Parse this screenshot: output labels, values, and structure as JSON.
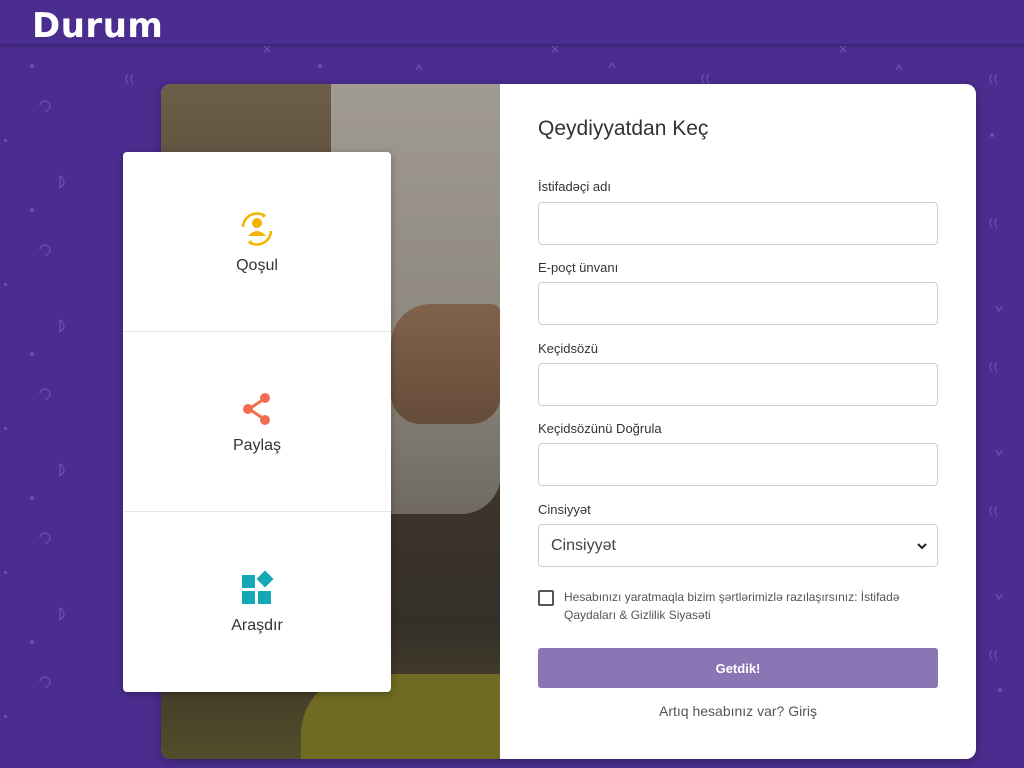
{
  "app": {
    "logo": "Durum"
  },
  "colors": {
    "brand_purple": "#4b2d8f",
    "button": "#8a76b4",
    "yellow": "#f5b301",
    "orange": "#f26d50",
    "teal": "#13a8b4"
  },
  "features": [
    {
      "label": "Qoşul",
      "icon": "user-connect-icon"
    },
    {
      "label": "Paylaş",
      "icon": "share-icon"
    },
    {
      "label": "Araşdır",
      "icon": "explore-icon"
    }
  ],
  "form": {
    "title": "Qeydiyyatdan Keç",
    "username_label": "İstifadəçi adı",
    "username_value": "",
    "email_label": "E-poçt ünvanı",
    "email_value": "",
    "password_label": "Keçidsözü",
    "password_value": "",
    "confirm_label": "Keçidsözünü Doğrula",
    "confirm_value": "",
    "gender_label": "Cinsiyyət",
    "gender_selected": "Cinsiyyət",
    "agree_text_prefix": "Hesabınızı yaratmaqla bizim şərtlərimizlə razılaşırsınız:",
    "agree_link": "İstifadə Qaydaları & Gizlilik Siyasəti",
    "submit_label": "Getdik!",
    "login_prompt": "Artıq hesabınız var?",
    "login_link": "Giriş"
  }
}
